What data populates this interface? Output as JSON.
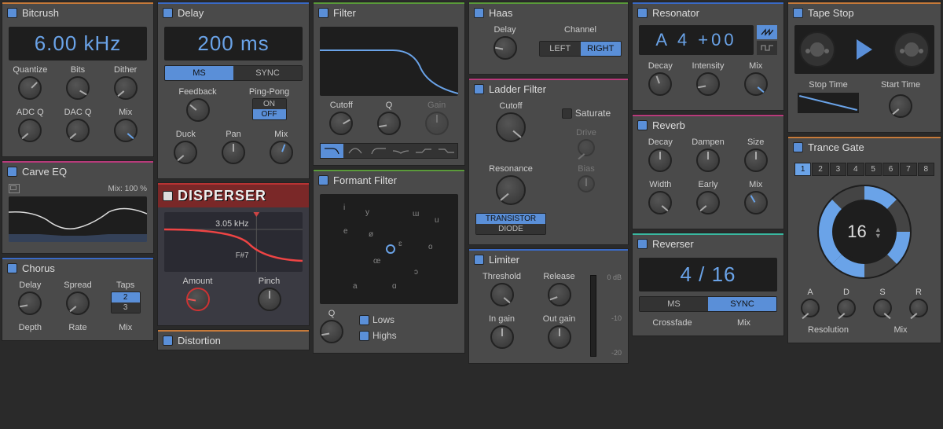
{
  "colors": {
    "accent": "#5a8fd8",
    "bar_orange": "#c67a3a",
    "bar_blue": "#3a6ac6",
    "bar_green": "#5a9a3a",
    "bar_magenta": "#b83a7a",
    "bar_teal": "#3ab8a0",
    "bar_red": "#b83333"
  },
  "bitcrush": {
    "title": "Bitcrush",
    "display": "6.00 kHz",
    "knobs1": [
      "Quantize",
      "Bits",
      "Dither"
    ],
    "knobs2": [
      "ADC Q",
      "DAC Q",
      "Mix"
    ]
  },
  "carve_eq": {
    "title": "Carve EQ",
    "mix_label": "Mix: 100 %"
  },
  "chorus": {
    "title": "Chorus",
    "row1": [
      "Delay",
      "Spread",
      "Taps"
    ],
    "taps_options": [
      "2",
      "3"
    ],
    "row2": [
      "Depth",
      "Rate",
      "Mix"
    ]
  },
  "delay": {
    "title": "Delay",
    "display": "200 ms",
    "mode_options": [
      "MS",
      "SYNC"
    ],
    "row1": [
      "Feedback",
      "Ping-Pong"
    ],
    "pingpong_options": [
      "ON",
      "OFF"
    ],
    "row2": [
      "Duck",
      "Pan",
      "Mix"
    ]
  },
  "disperser": {
    "title": "DISPERSER",
    "freq": "3.05 kHz",
    "note": "F#7",
    "knobs": [
      "Amount",
      "Pinch"
    ]
  },
  "distortion": {
    "title": "Distortion"
  },
  "filter": {
    "title": "Filter",
    "knobs": [
      "Cutoff",
      "Q",
      "Gain"
    ]
  },
  "formant": {
    "title": "Formant Filter",
    "vowels": [
      "i",
      "y",
      "e",
      "ø",
      "œ",
      "ɛ",
      "a",
      "ɑ",
      "ɔ",
      "o",
      "u",
      "ɯ"
    ],
    "q_label": "Q",
    "check1": "Lows",
    "check2": "Highs"
  },
  "haas": {
    "title": "Haas",
    "row": [
      "Delay",
      "Channel"
    ],
    "channel_options": [
      "LEFT",
      "RIGHT"
    ]
  },
  "ladder": {
    "title": "Ladder Filter",
    "row1": [
      "Cutoff",
      "Saturate"
    ],
    "drive_label": "Drive",
    "resonance_label": "Resonance",
    "bias_label": "Bias",
    "mode_options": [
      "TRANSISTOR",
      "DIODE"
    ]
  },
  "limiter": {
    "title": "Limiter",
    "row1": [
      "Threshold",
      "Release"
    ],
    "row2": [
      "In gain",
      "Out gain"
    ],
    "meter_ticks": [
      "0 dB",
      "-10",
      "-20"
    ]
  },
  "resonator": {
    "title": "Resonator",
    "display": "A 4 +00",
    "row": [
      "Decay",
      "Intensity",
      "Mix"
    ]
  },
  "reverb": {
    "title": "Reverb",
    "row1": [
      "Decay",
      "Dampen",
      "Size"
    ],
    "row2": [
      "Width",
      "Early",
      "Mix"
    ]
  },
  "reverser": {
    "title": "Reverser",
    "display": "4 / 16",
    "mode_options": [
      "MS",
      "SYNC"
    ],
    "row": [
      "Crossfade",
      "Mix"
    ]
  },
  "tape_stop": {
    "title": "Tape Stop",
    "row": [
      "Stop Time",
      "Start Time"
    ]
  },
  "trance_gate": {
    "title": "Trance Gate",
    "steps": [
      "1",
      "2",
      "3",
      "4",
      "5",
      "6",
      "7",
      "8"
    ],
    "value": "16",
    "adsr": [
      "A",
      "D",
      "S",
      "R"
    ],
    "row2": [
      "Resolution",
      "Mix"
    ]
  }
}
